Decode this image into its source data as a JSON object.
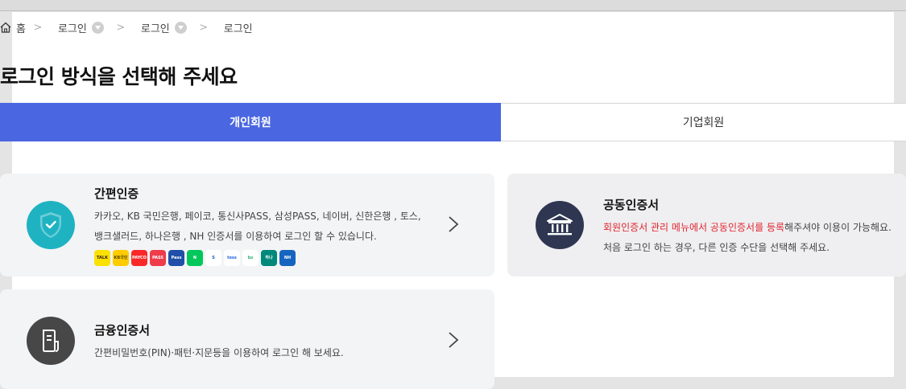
{
  "breadcrumb": {
    "home": "홈",
    "items": [
      "로그인",
      "로그인",
      "로그인"
    ]
  },
  "page_title": "로그인 방식을 선택해 주세요",
  "tabs": {
    "personal": "개인회원",
    "corporate": "기업회원"
  },
  "easy_auth": {
    "title": "간편인증",
    "desc_line1": "카카오, KB 국민은행, 페이코, 통신사PASS, 삼성PASS, 네이버, 신한은행 , 토스,",
    "desc_line2": "뱅크샐러드, 하나은행 , NH 인증서를 이용하여 로그인 할 수 있습니다.",
    "brands": [
      {
        "name": "kakao",
        "label": "TALK",
        "bg": "#fae100",
        "fg": "#3a1d1d"
      },
      {
        "name": "kb",
        "label": "KB국민",
        "bg": "#ffcc00",
        "fg": "#5a4a00"
      },
      {
        "name": "payco",
        "label": "PAYCO",
        "bg": "#fa2828",
        "fg": "#ffffff"
      },
      {
        "name": "pass",
        "label": "PASS",
        "bg": "#ef3b4a",
        "fg": "#ffffff"
      },
      {
        "name": "samsung-pass",
        "label": "Pass",
        "bg": "#1f4fa8",
        "fg": "#ffffff"
      },
      {
        "name": "naver",
        "label": "N",
        "bg": "#03c75a",
        "fg": "#ffffff"
      },
      {
        "name": "shinhan",
        "label": "S",
        "bg": "#ffffff",
        "fg": "#1a56c8"
      },
      {
        "name": "toss",
        "label": "toss",
        "bg": "#ffffff",
        "fg": "#1b64da"
      },
      {
        "name": "banksalad",
        "label": "bs",
        "bg": "#ffffff",
        "fg": "#22b573"
      },
      {
        "name": "hana",
        "label": "하나",
        "bg": "#00897b",
        "fg": "#ffffff"
      },
      {
        "name": "nh",
        "label": "NH",
        "bg": "#1565c0",
        "fg": "#ffffff"
      }
    ]
  },
  "joint_cert": {
    "title": "공동인증서",
    "desc_red": "회원인증서 관리 메뉴에서 공동인증서를 등록",
    "desc_rest": "해주셔야 이용이 가능해요.",
    "desc_line2": "처음 로그인 하는 경우, 다른 인증 수단을 선택해 주세요."
  },
  "fin_cert": {
    "title": "금융인증서",
    "desc": "간편비밀번호(PIN)·패턴·지문등을 이용하여 로그인 해 보세요."
  },
  "colors": {
    "accent": "#4a66e1",
    "teal": "#1fb3c2",
    "navy": "#2f3651",
    "dark": "#474747",
    "red": "#e0242f"
  }
}
